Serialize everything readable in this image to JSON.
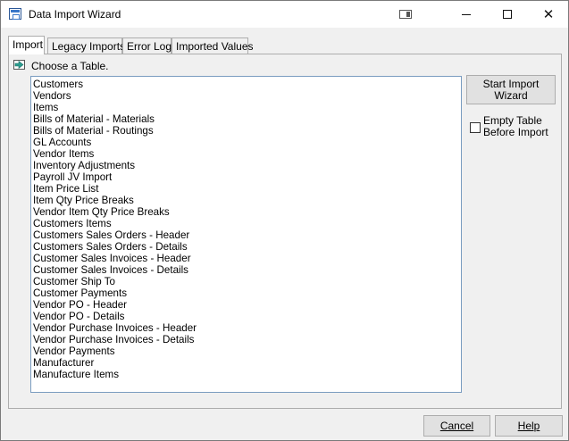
{
  "window": {
    "title": "Data Import Wizard",
    "controls": {
      "minimize": "minimize",
      "maximize": "maximize",
      "close": "✕"
    }
  },
  "tabs": [
    {
      "label": "Import",
      "active": true
    },
    {
      "label": "Legacy Imports",
      "active": false
    },
    {
      "label": "Error Log",
      "active": false
    },
    {
      "label": "Imported Values",
      "active": false
    }
  ],
  "import_panel": {
    "prompt": "Choose a Table.",
    "tables": [
      "Customers",
      "Vendors",
      "Items",
      "Bills of Material - Materials",
      "Bills of Material - Routings",
      "GL Accounts",
      "Vendor Items",
      "Inventory Adjustments",
      "Payroll JV Import",
      "Item Price List",
      "Item Qty Price Breaks",
      "Vendor Item Qty Price Breaks",
      "Customers Items",
      "Customers Sales Orders - Header",
      "Customers Sales Orders - Details",
      "Customer Sales Invoices - Header",
      "Customer Sales Invoices - Details",
      "Customer Ship To",
      "Customer Payments",
      "Vendor PO - Header",
      "Vendor PO - Details",
      "Vendor Purchase Invoices - Header",
      "Vendor Purchase Invoices - Details",
      "Vendor Payments",
      "Manufacturer",
      "Manufacture Items"
    ],
    "start_button": {
      "line1": "Start Import",
      "line2": "Wizard"
    },
    "empty_table_checkbox": {
      "line1": "Empty Table",
      "line2": "Before Import",
      "checked": false
    }
  },
  "footer": {
    "cancel_label": "Cancel",
    "help_label": "Help"
  },
  "colors": {
    "window_bg": "#f0f0f0",
    "listbox_border": "#7a9cc0",
    "arrow_fill": "#2a9d8f"
  }
}
